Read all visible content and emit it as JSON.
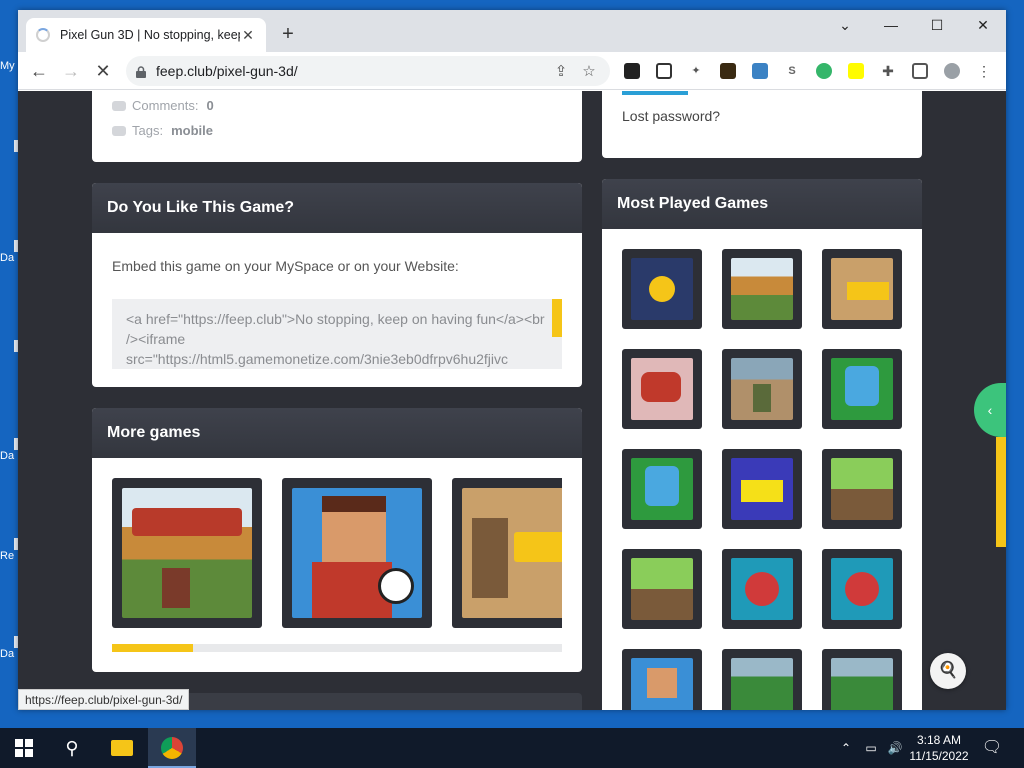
{
  "browser": {
    "tab_title": "Pixel Gun 3D | No stopping, keep",
    "new_tab": "+",
    "url": "feep.club/pixel-gun-3d/",
    "status_url": "https://feep.club/pixel-gun-3d/"
  },
  "post_meta": {
    "comments_label": "Comments:",
    "comments_count": "0",
    "tags_label": "Tags:",
    "tags_value": "mobile"
  },
  "login": {
    "lost_password": "Lost password?"
  },
  "embed": {
    "heading": "Do You Like This Game?",
    "intro": "Embed this game on your MySpace or on your Website:",
    "code": "<a href=\"https://feep.club\">No stopping, keep on having fun</a><br /><iframe src=\"https://html5.gamemonetize.com/3nie3eb0dfrpv6hu2fjivc"
  },
  "more_games": {
    "heading": "More games",
    "progress_fraction": 0.18
  },
  "most_played": {
    "heading": "Most Played Games"
  },
  "taskbar": {
    "time": "3:18 AM",
    "date": "11/15/2022"
  },
  "desktop_labels": [
    "My",
    "Da",
    "Da",
    "Re",
    "Da"
  ]
}
